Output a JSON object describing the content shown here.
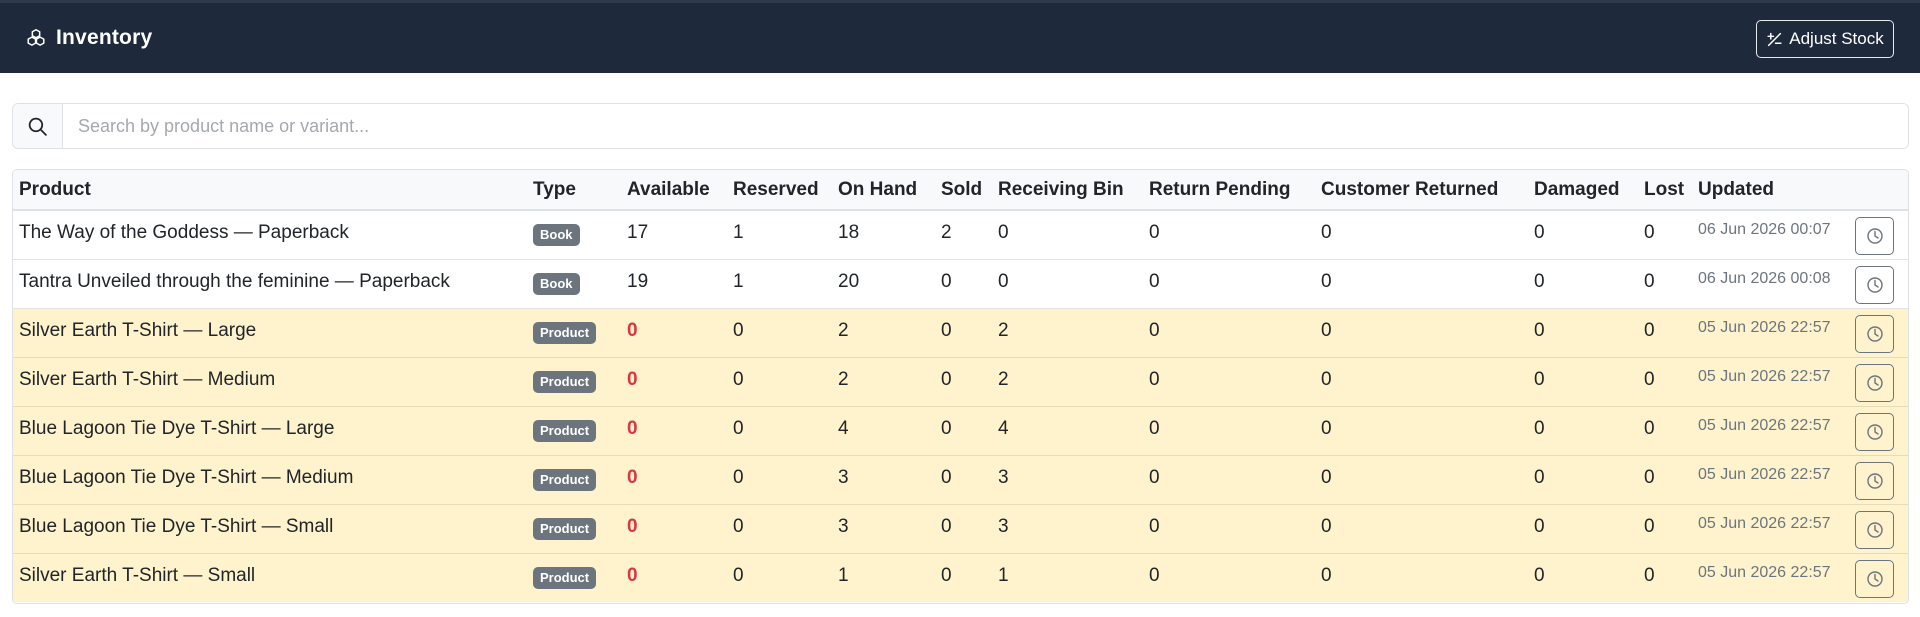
{
  "header": {
    "title": "Inventory",
    "logo_icon": "boxes-icon",
    "adjust_button": "Adjust Stock",
    "adjust_icon": "plus-slash-minus-icon"
  },
  "search": {
    "placeholder": "Search by product name or variant...",
    "value": ""
  },
  "table": {
    "columns": [
      "Product",
      "Type",
      "Available",
      "Reserved",
      "On Hand",
      "Sold",
      "Receiving Bin",
      "Return Pending",
      "Customer Returned",
      "Damaged",
      "Lost",
      "Updated"
    ],
    "rows": [
      {
        "product": "The Way of the Goddess — Paperback",
        "type": "Book",
        "available": "17",
        "reserved": "1",
        "on_hand": "18",
        "sold": "2",
        "receiving_bin": "0",
        "return_pending": "0",
        "customer_returned": "0",
        "damaged": "0",
        "lost": "0",
        "updated": "06 Jun 2026 00:07",
        "highlight": false
      },
      {
        "product": "Tantra Unveiled through the feminine — Paperback",
        "type": "Book",
        "available": "19",
        "reserved": "1",
        "on_hand": "20",
        "sold": "0",
        "receiving_bin": "0",
        "return_pending": "0",
        "customer_returned": "0",
        "damaged": "0",
        "lost": "0",
        "updated": "06 Jun 2026 00:08",
        "highlight": false
      },
      {
        "product": "Silver Earth T-Shirt — Large",
        "type": "Product",
        "available": "0",
        "reserved": "0",
        "on_hand": "2",
        "sold": "0",
        "receiving_bin": "2",
        "return_pending": "0",
        "customer_returned": "0",
        "damaged": "0",
        "lost": "0",
        "updated": "05 Jun 2026 22:57",
        "highlight": true
      },
      {
        "product": "Silver Earth T-Shirt — Medium",
        "type": "Product",
        "available": "0",
        "reserved": "0",
        "on_hand": "2",
        "sold": "0",
        "receiving_bin": "2",
        "return_pending": "0",
        "customer_returned": "0",
        "damaged": "0",
        "lost": "0",
        "updated": "05 Jun 2026 22:57",
        "highlight": true
      },
      {
        "product": "Blue Lagoon Tie Dye T-Shirt — Large",
        "type": "Product",
        "available": "0",
        "reserved": "0",
        "on_hand": "4",
        "sold": "0",
        "receiving_bin": "4",
        "return_pending": "0",
        "customer_returned": "0",
        "damaged": "0",
        "lost": "0",
        "updated": "05 Jun 2026 22:57",
        "highlight": true
      },
      {
        "product": "Blue Lagoon Tie Dye T-Shirt — Medium",
        "type": "Product",
        "available": "0",
        "reserved": "0",
        "on_hand": "3",
        "sold": "0",
        "receiving_bin": "3",
        "return_pending": "0",
        "customer_returned": "0",
        "damaged": "0",
        "lost": "0",
        "updated": "05 Jun 2026 22:57",
        "highlight": true
      },
      {
        "product": "Blue Lagoon Tie Dye T-Shirt — Small",
        "type": "Product",
        "available": "0",
        "reserved": "0",
        "on_hand": "3",
        "sold": "0",
        "receiving_bin": "3",
        "return_pending": "0",
        "customer_returned": "0",
        "damaged": "0",
        "lost": "0",
        "updated": "05 Jun 2026 22:57",
        "highlight": true
      },
      {
        "product": "Silver Earth T-Shirt — Small",
        "type": "Product",
        "available": "0",
        "reserved": "0",
        "on_hand": "1",
        "sold": "0",
        "receiving_bin": "1",
        "return_pending": "0",
        "customer_returned": "0",
        "damaged": "0",
        "lost": "0",
        "updated": "05 Jun 2026 22:57",
        "highlight": true
      }
    ],
    "history_icon": "clock-icon"
  },
  "colors": {
    "navbar": "#1e2a3b",
    "warning_row": "#fff3cd",
    "zero_available": "#dc3545",
    "badge": "#6c757d"
  }
}
